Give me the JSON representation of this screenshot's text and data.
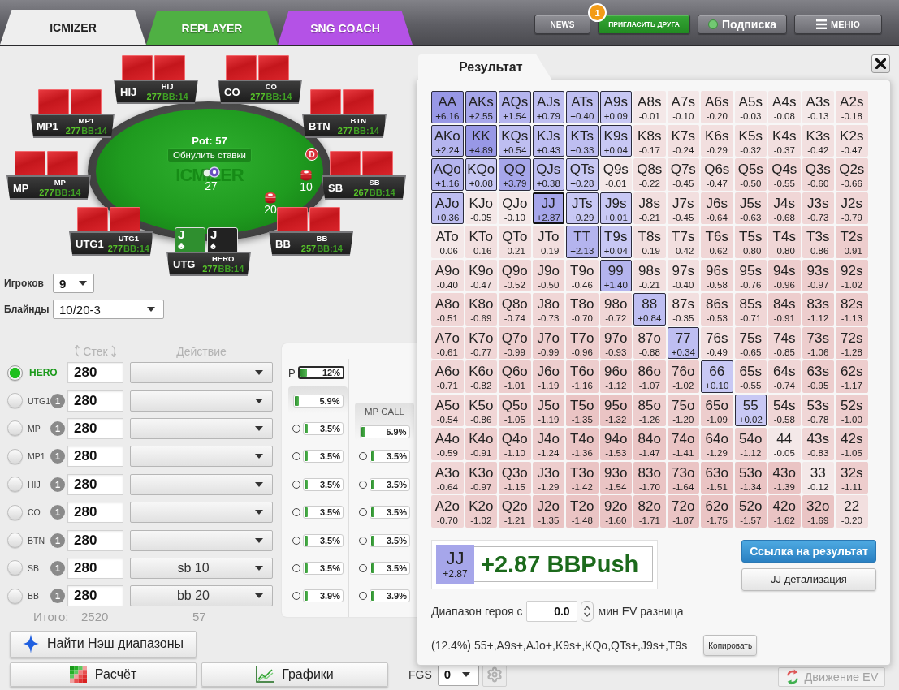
{
  "tabs": [
    {
      "label": "ICMIZER",
      "selected": true,
      "color": "#eeeeee"
    },
    {
      "label": "REPLAYER",
      "selected": false,
      "color": "#4fb043"
    },
    {
      "label": "SNG COACH",
      "selected": false,
      "color": "#b452e6"
    }
  ],
  "header_buttons": [
    {
      "kind": "plain",
      "label": "NEWS"
    },
    {
      "kind": "invite",
      "label": "ПРИГЛАСИТЬ ДРУГА",
      "badge": "1"
    },
    {
      "kind": "status",
      "label": "Подписка",
      "active": true
    },
    {
      "kind": "menu",
      "label": "МЕНЮ"
    }
  ],
  "table": {
    "pot": "Pot: 57",
    "reset_button": "Обнулить ставки",
    "felt_logo": "ICMIZER",
    "antes": "27",
    "dealer_button": "D",
    "seats": [
      {
        "position": "HIJ",
        "name": "HIJ",
        "stack": "277",
        "big_blinds": "BB:14",
        "cards": [
          {
            "face_up": false
          },
          {
            "face_up": false
          }
        ]
      },
      {
        "position": "CO",
        "name": "CO",
        "stack": "277",
        "big_blinds": "BB:14",
        "cards": [
          {
            "face_up": false
          },
          {
            "face_up": false
          }
        ]
      },
      {
        "position": "MP1",
        "name": "MP1",
        "stack": "277",
        "big_blinds": "BB:14",
        "cards": [
          {
            "face_up": false
          },
          {
            "face_up": false
          }
        ]
      },
      {
        "position": "BTN",
        "name": "BTN",
        "stack": "277",
        "big_blinds": "BB:14",
        "cards": [
          {
            "face_up": false
          },
          {
            "face_up": false
          }
        ]
      },
      {
        "position": "MP",
        "name": "MP",
        "stack": "277",
        "big_blinds": "BB:14",
        "cards": [
          {
            "face_up": false
          },
          {
            "face_up": false
          }
        ]
      },
      {
        "position": "SB",
        "name": "SB",
        "stack": "267",
        "big_blinds": "BB:14",
        "bet": "10",
        "cards": [
          {
            "face_up": false
          },
          {
            "face_up": false
          }
        ]
      },
      {
        "position": "UTG1",
        "name": "UTG1",
        "stack": "277",
        "big_blinds": "BB:14",
        "cards": [
          {
            "face_up": false
          },
          {
            "face_up": false
          }
        ]
      },
      {
        "position": "BB",
        "name": "BB",
        "stack": "257",
        "big_blinds": "BB:14",
        "bet": "20",
        "cards": [
          {
            "face_up": false
          },
          {
            "face_up": false
          }
        ]
      },
      {
        "position": "UTG",
        "name": "HERO",
        "stack": "277",
        "big_blinds": "BB:14",
        "cards": [
          {
            "face_up": true,
            "rank": "J",
            "suit": "♣",
            "color": "#2f8f2f"
          },
          {
            "face_up": true,
            "rank": "J",
            "suit": "♠",
            "color": "#222222"
          }
        ]
      }
    ]
  },
  "settings": [
    {
      "label": "Игроков",
      "value": "9"
    },
    {
      "label": "Блайнды",
      "value": "10/20-3"
    }
  ],
  "players_header": {
    "stack": "Стек",
    "action": "Действие"
  },
  "players": [
    {
      "name": "HERO",
      "selected": true,
      "stack": "280"
    },
    {
      "name": "UTG1",
      "selected": false,
      "badge": "1",
      "stack": "280"
    },
    {
      "name": "MP",
      "selected": false,
      "badge": "1",
      "stack": "280"
    },
    {
      "name": "MP1",
      "selected": false,
      "badge": "1",
      "stack": "280"
    },
    {
      "name": "HIJ",
      "selected": false,
      "badge": "1",
      "stack": "280"
    },
    {
      "name": "CO",
      "selected": false,
      "badge": "1",
      "stack": "280"
    },
    {
      "name": "BTN",
      "selected": false,
      "badge": "1",
      "stack": "280"
    },
    {
      "name": "SB",
      "selected": false,
      "badge": "1",
      "stack": "280",
      "action": "sb 10"
    },
    {
      "name": "BB",
      "selected": false,
      "badge": "1",
      "stack": "280",
      "action": "bb 20"
    }
  ],
  "totals": {
    "label": "Итого:",
    "stack": "2520",
    "bets": "57"
  },
  "range_columns": [
    {
      "lead": {
        "letter": "P",
        "reading": "12%",
        "level": 0.12
      },
      "head": {
        "reading": "5.9%",
        "level": 0.059
      },
      "rows": [
        {
          "reading": "3.5%",
          "level": 0.035
        },
        {
          "reading": "3.5%",
          "level": 0.035
        },
        {
          "reading": "3.5%",
          "level": 0.035
        },
        {
          "reading": "3.5%",
          "level": 0.035
        },
        {
          "reading": "3.5%",
          "level": 0.035
        },
        {
          "reading": "3.5%",
          "level": 0.035
        },
        {
          "reading": "3.9%",
          "level": 0.039
        }
      ]
    },
    {
      "title": "MP CALL",
      "head": {
        "reading": "5.9%",
        "level": 0.059
      },
      "rows": [
        {
          "reading": "3.5%",
          "level": 0.035
        },
        {
          "reading": "3.5%",
          "level": 0.035
        },
        {
          "reading": "3.5%",
          "level": 0.035
        },
        {
          "reading": "3.5%",
          "level": 0.035
        },
        {
          "reading": "3.5%",
          "level": 0.035
        },
        {
          "reading": "3.9%",
          "level": 0.039
        }
      ]
    }
  ],
  "nash_button": "Найти Нэш диапазоны",
  "bottom_bar": {
    "calc_button": "Расчёт",
    "charts_button": "Графики",
    "fgs_label": "FGS",
    "fgs_value": "0",
    "ev_button": {
      "label": "Движение EV",
      "disabled": true
    }
  },
  "result": {
    "tab": "Результат",
    "grid": [
      [
        {
          "hand": "AA",
          "ev": "+6.16",
          "color": "#9898e6",
          "push": true,
          "selected": false
        },
        {
          "hand": "AKs",
          "ev": "+2.55",
          "color": "#a6a6ea",
          "push": true,
          "selected": false
        },
        {
          "hand": "AQs",
          "ev": "+1.54",
          "color": "#b4b4ee",
          "push": true,
          "selected": false
        },
        {
          "hand": "AJs",
          "ev": "+0.79",
          "color": "#bebef1",
          "push": true,
          "selected": false
        },
        {
          "hand": "ATs",
          "ev": "+0.40",
          "color": "#bebef1",
          "push": true,
          "selected": false
        },
        {
          "hand": "A9s",
          "ev": "+0.09",
          "color": "#c8c8f4",
          "push": true,
          "selected": false
        },
        {
          "hand": "A8s",
          "ev": "-0.01",
          "color": "#f4e8e8",
          "push": false,
          "selected": false
        },
        {
          "hand": "A7s",
          "ev": "-0.10",
          "color": "#f4e8e8",
          "push": false,
          "selected": false
        },
        {
          "hand": "A6s",
          "ev": "-0.20",
          "color": "#f2dfdf",
          "push": false,
          "selected": false
        },
        {
          "hand": "A5s",
          "ev": "-0.03",
          "color": "#f4e8e8",
          "push": false,
          "selected": false
        },
        {
          "hand": "A4s",
          "ev": "-0.08",
          "color": "#f4e8e8",
          "push": false,
          "selected": false
        },
        {
          "hand": "A3s",
          "ev": "-0.13",
          "color": "#f4e8e8",
          "push": false,
          "selected": false
        },
        {
          "hand": "A2s",
          "ev": "-0.18",
          "color": "#f2dfdf",
          "push": false,
          "selected": false
        }
      ],
      [
        {
          "hand": "AKo",
          "ev": "+2.24",
          "color": "#b4b4ee",
          "push": true,
          "selected": false
        },
        {
          "hand": "KK",
          "ev": "+4.89",
          "color": "#9898e6",
          "push": true,
          "selected": false
        },
        {
          "hand": "KQs",
          "ev": "+0.54",
          "color": "#bebef1",
          "push": true,
          "selected": false
        },
        {
          "hand": "KJs",
          "ev": "+0.43",
          "color": "#bebef1",
          "push": true,
          "selected": false
        },
        {
          "hand": "KTs",
          "ev": "+0.33",
          "color": "#bebef1",
          "push": true,
          "selected": false
        },
        {
          "hand": "K9s",
          "ev": "+0.04",
          "color": "#c8c8f4",
          "push": true,
          "selected": false
        },
        {
          "hand": "K8s",
          "ev": "-0.17",
          "color": "#f2dfdf",
          "push": false,
          "selected": false
        },
        {
          "hand": "K7s",
          "ev": "-0.24",
          "color": "#f2dfdf",
          "push": false,
          "selected": false
        },
        {
          "hand": "K6s",
          "ev": "-0.29",
          "color": "#f2dfdf",
          "push": false,
          "selected": false
        },
        {
          "hand": "K5s",
          "ev": "-0.32",
          "color": "#f2dfdf",
          "push": false,
          "selected": false
        },
        {
          "hand": "K4s",
          "ev": "-0.37",
          "color": "#f2dfdf",
          "push": false,
          "selected": false
        },
        {
          "hand": "K3s",
          "ev": "-0.42",
          "color": "#f2dfdf",
          "push": false,
          "selected": false
        },
        {
          "hand": "K2s",
          "ev": "-0.47",
          "color": "#f2dfdf",
          "push": false,
          "selected": false
        }
      ],
      [
        {
          "hand": "AQo",
          "ev": "+1.16",
          "color": "#b4b4ee",
          "push": true,
          "selected": false
        },
        {
          "hand": "KQo",
          "ev": "+0.08",
          "color": "#c8c8f4",
          "push": true,
          "selected": false
        },
        {
          "hand": "QQ",
          "ev": "+3.79",
          "color": "#a6a6ea",
          "push": true,
          "selected": false
        },
        {
          "hand": "QJs",
          "ev": "+0.38",
          "color": "#bebef1",
          "push": true,
          "selected": false
        },
        {
          "hand": "QTs",
          "ev": "+0.28",
          "color": "#c8c8f4",
          "push": true,
          "selected": false
        },
        {
          "hand": "Q9s",
          "ev": "-0.01",
          "color": "#f4e8e8",
          "push": false,
          "selected": false
        },
        {
          "hand": "Q8s",
          "ev": "-0.22",
          "color": "#f2dfdf",
          "push": false,
          "selected": false
        },
        {
          "hand": "Q7s",
          "ev": "-0.45",
          "color": "#f2dfdf",
          "push": false,
          "selected": false
        },
        {
          "hand": "Q6s",
          "ev": "-0.47",
          "color": "#f2dfdf",
          "push": false,
          "selected": false
        },
        {
          "hand": "Q5s",
          "ev": "-0.50",
          "color": "#f0d6d6",
          "push": false,
          "selected": false
        },
        {
          "hand": "Q4s",
          "ev": "-0.55",
          "color": "#f0d6d6",
          "push": false,
          "selected": false
        },
        {
          "hand": "Q3s",
          "ev": "-0.60",
          "color": "#f0d6d6",
          "push": false,
          "selected": false
        },
        {
          "hand": "Q2s",
          "ev": "-0.66",
          "color": "#f0d6d6",
          "push": false,
          "selected": false
        }
      ],
      [
        {
          "hand": "AJo",
          "ev": "+0.36",
          "color": "#bebef1",
          "push": true,
          "selected": false
        },
        {
          "hand": "KJo",
          "ev": "-0.05",
          "color": "#f4e8e8",
          "push": false,
          "selected": false
        },
        {
          "hand": "QJo",
          "ev": "-0.10",
          "color": "#f4e8e8",
          "push": false,
          "selected": false
        },
        {
          "hand": "JJ",
          "ev": "+2.87",
          "color": "#a6a6ea",
          "push": true,
          "selected": true
        },
        {
          "hand": "JTs",
          "ev": "+0.29",
          "color": "#c8c8f4",
          "push": true,
          "selected": false
        },
        {
          "hand": "J9s",
          "ev": "+0.01",
          "color": "#c8c8f4",
          "push": true,
          "selected": false
        },
        {
          "hand": "J8s",
          "ev": "-0.21",
          "color": "#f2dfdf",
          "push": false,
          "selected": false
        },
        {
          "hand": "J7s",
          "ev": "-0.45",
          "color": "#f2dfdf",
          "push": false,
          "selected": false
        },
        {
          "hand": "J6s",
          "ev": "-0.64",
          "color": "#f0d6d6",
          "push": false,
          "selected": false
        },
        {
          "hand": "J5s",
          "ev": "-0.63",
          "color": "#f0d6d6",
          "push": false,
          "selected": false
        },
        {
          "hand": "J4s",
          "ev": "-0.68",
          "color": "#f0d6d6",
          "push": false,
          "selected": false
        },
        {
          "hand": "J3s",
          "ev": "-0.73",
          "color": "#f0d6d6",
          "push": false,
          "selected": false
        },
        {
          "hand": "J2s",
          "ev": "-0.79",
          "color": "#f0d6d6",
          "push": false,
          "selected": false
        }
      ],
      [
        {
          "hand": "ATo",
          "ev": "-0.06",
          "color": "#f4e8e8",
          "push": false,
          "selected": false
        },
        {
          "hand": "KTo",
          "ev": "-0.16",
          "color": "#f2dfdf",
          "push": false,
          "selected": false
        },
        {
          "hand": "QTo",
          "ev": "-0.21",
          "color": "#f2dfdf",
          "push": false,
          "selected": false
        },
        {
          "hand": "JTo",
          "ev": "-0.19",
          "color": "#f2dfdf",
          "push": false,
          "selected": false
        },
        {
          "hand": "TT",
          "ev": "+2.13",
          "color": "#b4b4ee",
          "push": true,
          "selected": false
        },
        {
          "hand": "T9s",
          "ev": "+0.04",
          "color": "#c8c8f4",
          "push": true,
          "selected": false
        },
        {
          "hand": "T8s",
          "ev": "-0.19",
          "color": "#f2dfdf",
          "push": false,
          "selected": false
        },
        {
          "hand": "T7s",
          "ev": "-0.42",
          "color": "#f2dfdf",
          "push": false,
          "selected": false
        },
        {
          "hand": "T6s",
          "ev": "-0.62",
          "color": "#f0d6d6",
          "push": false,
          "selected": false
        },
        {
          "hand": "T5s",
          "ev": "-0.80",
          "color": "#f0d6d6",
          "push": false,
          "selected": false
        },
        {
          "hand": "T4s",
          "ev": "-0.80",
          "color": "#f0d6d6",
          "push": false,
          "selected": false
        },
        {
          "hand": "T3s",
          "ev": "-0.86",
          "color": "#f0d6d6",
          "push": false,
          "selected": false
        },
        {
          "hand": "T2s",
          "ev": "-0.91",
          "color": "#edcdcd",
          "push": false,
          "selected": false
        }
      ],
      [
        {
          "hand": "A9o",
          "ev": "-0.40",
          "color": "#f2dfdf",
          "push": false,
          "selected": false
        },
        {
          "hand": "K9o",
          "ev": "-0.47",
          "color": "#f2dfdf",
          "push": false,
          "selected": false
        },
        {
          "hand": "Q9o",
          "ev": "-0.52",
          "color": "#f0d6d6",
          "push": false,
          "selected": false
        },
        {
          "hand": "J9o",
          "ev": "-0.50",
          "color": "#f0d6d6",
          "push": false,
          "selected": false
        },
        {
          "hand": "T9o",
          "ev": "-0.46",
          "color": "#f2dfdf",
          "push": false,
          "selected": false
        },
        {
          "hand": "99",
          "ev": "+1.40",
          "color": "#b4b4ee",
          "push": true,
          "selected": false
        },
        {
          "hand": "98s",
          "ev": "-0.21",
          "color": "#f2dfdf",
          "push": false,
          "selected": false
        },
        {
          "hand": "97s",
          "ev": "-0.40",
          "color": "#f2dfdf",
          "push": false,
          "selected": false
        },
        {
          "hand": "96s",
          "ev": "-0.58",
          "color": "#f0d6d6",
          "push": false,
          "selected": false
        },
        {
          "hand": "95s",
          "ev": "-0.76",
          "color": "#f0d6d6",
          "push": false,
          "selected": false
        },
        {
          "hand": "94s",
          "ev": "-0.96",
          "color": "#edcdcd",
          "push": false,
          "selected": false
        },
        {
          "hand": "93s",
          "ev": "-0.97",
          "color": "#edcdcd",
          "push": false,
          "selected": false
        },
        {
          "hand": "92s",
          "ev": "-1.02",
          "color": "#edcdcd",
          "push": false,
          "selected": false
        }
      ],
      [
        {
          "hand": "A8o",
          "ev": "-0.51",
          "color": "#f0d6d6",
          "push": false,
          "selected": false
        },
        {
          "hand": "K8o",
          "ev": "-0.69",
          "color": "#f0d6d6",
          "push": false,
          "selected": false
        },
        {
          "hand": "Q8o",
          "ev": "-0.74",
          "color": "#f0d6d6",
          "push": false,
          "selected": false
        },
        {
          "hand": "J8o",
          "ev": "-0.73",
          "color": "#f0d6d6",
          "push": false,
          "selected": false
        },
        {
          "hand": "T8o",
          "ev": "-0.70",
          "color": "#f0d6d6",
          "push": false,
          "selected": false
        },
        {
          "hand": "98o",
          "ev": "-0.72",
          "color": "#f0d6d6",
          "push": false,
          "selected": false
        },
        {
          "hand": "88",
          "ev": "+0.84",
          "color": "#bebef1",
          "push": true,
          "selected": false
        },
        {
          "hand": "87s",
          "ev": "-0.35",
          "color": "#f2dfdf",
          "push": false,
          "selected": false
        },
        {
          "hand": "86s",
          "ev": "-0.53",
          "color": "#f0d6d6",
          "push": false,
          "selected": false
        },
        {
          "hand": "85s",
          "ev": "-0.71",
          "color": "#f0d6d6",
          "push": false,
          "selected": false
        },
        {
          "hand": "84s",
          "ev": "-0.91",
          "color": "#edcdcd",
          "push": false,
          "selected": false
        },
        {
          "hand": "83s",
          "ev": "-1.12",
          "color": "#edcdcd",
          "push": false,
          "selected": false
        },
        {
          "hand": "82s",
          "ev": "-1.13",
          "color": "#edcdcd",
          "push": false,
          "selected": false
        }
      ],
      [
        {
          "hand": "A7o",
          "ev": "-0.61",
          "color": "#f0d6d6",
          "push": false,
          "selected": false
        },
        {
          "hand": "K7o",
          "ev": "-0.77",
          "color": "#f0d6d6",
          "push": false,
          "selected": false
        },
        {
          "hand": "Q7o",
          "ev": "-0.99",
          "color": "#edcdcd",
          "push": false,
          "selected": false
        },
        {
          "hand": "J7o",
          "ev": "-0.99",
          "color": "#edcdcd",
          "push": false,
          "selected": false
        },
        {
          "hand": "T7o",
          "ev": "-0.96",
          "color": "#edcdcd",
          "push": false,
          "selected": false
        },
        {
          "hand": "97o",
          "ev": "-0.93",
          "color": "#edcdcd",
          "push": false,
          "selected": false
        },
        {
          "hand": "87o",
          "ev": "-0.88",
          "color": "#f0d6d6",
          "push": false,
          "selected": false
        },
        {
          "hand": "77",
          "ev": "+0.34",
          "color": "#bebef1",
          "push": true,
          "selected": false
        },
        {
          "hand": "76s",
          "ev": "-0.49",
          "color": "#f2dfdf",
          "push": false,
          "selected": false
        },
        {
          "hand": "75s",
          "ev": "-0.65",
          "color": "#f0d6d6",
          "push": false,
          "selected": false
        },
        {
          "hand": "74s",
          "ev": "-0.85",
          "color": "#f0d6d6",
          "push": false,
          "selected": false
        },
        {
          "hand": "73s",
          "ev": "-1.06",
          "color": "#edcdcd",
          "push": false,
          "selected": false
        },
        {
          "hand": "72s",
          "ev": "-1.28",
          "color": "#edcdcd",
          "push": false,
          "selected": false
        }
      ],
      [
        {
          "hand": "A6o",
          "ev": "-0.71",
          "color": "#f0d6d6",
          "push": false,
          "selected": false
        },
        {
          "hand": "K6o",
          "ev": "-0.82",
          "color": "#f0d6d6",
          "push": false,
          "selected": false
        },
        {
          "hand": "Q6o",
          "ev": "-1.01",
          "color": "#edcdcd",
          "push": false,
          "selected": false
        },
        {
          "hand": "J6o",
          "ev": "-1.19",
          "color": "#edcdcd",
          "push": false,
          "selected": false
        },
        {
          "hand": "T6o",
          "ev": "-1.16",
          "color": "#edcdcd",
          "push": false,
          "selected": false
        },
        {
          "hand": "96o",
          "ev": "-1.12",
          "color": "#edcdcd",
          "push": false,
          "selected": false
        },
        {
          "hand": "86o",
          "ev": "-1.07",
          "color": "#edcdcd",
          "push": false,
          "selected": false
        },
        {
          "hand": "76o",
          "ev": "-1.02",
          "color": "#edcdcd",
          "push": false,
          "selected": false
        },
        {
          "hand": "66",
          "ev": "+0.10",
          "color": "#c8c8f4",
          "push": true,
          "selected": false
        },
        {
          "hand": "65s",
          "ev": "-0.55",
          "color": "#f0d6d6",
          "push": false,
          "selected": false
        },
        {
          "hand": "64s",
          "ev": "-0.74",
          "color": "#f0d6d6",
          "push": false,
          "selected": false
        },
        {
          "hand": "63s",
          "ev": "-0.95",
          "color": "#edcdcd",
          "push": false,
          "selected": false
        },
        {
          "hand": "62s",
          "ev": "-1.17",
          "color": "#edcdcd",
          "push": false,
          "selected": false
        }
      ],
      [
        {
          "hand": "A5o",
          "ev": "-0.54",
          "color": "#f0d6d6",
          "push": false,
          "selected": false
        },
        {
          "hand": "K5o",
          "ev": "-0.86",
          "color": "#f0d6d6",
          "push": false,
          "selected": false
        },
        {
          "hand": "Q5o",
          "ev": "-1.05",
          "color": "#edcdcd",
          "push": false,
          "selected": false
        },
        {
          "hand": "J5o",
          "ev": "-1.19",
          "color": "#edcdcd",
          "push": false,
          "selected": false
        },
        {
          "hand": "T5o",
          "ev": "-1.35",
          "color": "#eac4c4",
          "push": false,
          "selected": false
        },
        {
          "hand": "95o",
          "ev": "-1.32",
          "color": "#eac4c4",
          "push": false,
          "selected": false
        },
        {
          "hand": "85o",
          "ev": "-1.26",
          "color": "#edcdcd",
          "push": false,
          "selected": false
        },
        {
          "hand": "75o",
          "ev": "-1.20",
          "color": "#edcdcd",
          "push": false,
          "selected": false
        },
        {
          "hand": "65o",
          "ev": "-1.09",
          "color": "#edcdcd",
          "push": false,
          "selected": false
        },
        {
          "hand": "55",
          "ev": "+0.02",
          "color": "#c8c8f4",
          "push": true,
          "selected": false
        },
        {
          "hand": "54s",
          "ev": "-0.58",
          "color": "#f0d6d6",
          "push": false,
          "selected": false
        },
        {
          "hand": "53s",
          "ev": "-0.78",
          "color": "#f0d6d6",
          "push": false,
          "selected": false
        },
        {
          "hand": "52s",
          "ev": "-1.00",
          "color": "#edcdcd",
          "push": false,
          "selected": false
        }
      ],
      [
        {
          "hand": "A4o",
          "ev": "-0.59",
          "color": "#f0d6d6",
          "push": false,
          "selected": false
        },
        {
          "hand": "K4o",
          "ev": "-0.91",
          "color": "#edcdcd",
          "push": false,
          "selected": false
        },
        {
          "hand": "Q4o",
          "ev": "-1.10",
          "color": "#edcdcd",
          "push": false,
          "selected": false
        },
        {
          "hand": "J4o",
          "ev": "-1.24",
          "color": "#edcdcd",
          "push": false,
          "selected": false
        },
        {
          "hand": "T4o",
          "ev": "-1.36",
          "color": "#eac4c4",
          "push": false,
          "selected": false
        },
        {
          "hand": "94o",
          "ev": "-1.53",
          "color": "#eac4c4",
          "push": false,
          "selected": false
        },
        {
          "hand": "84o",
          "ev": "-1.47",
          "color": "#eac4c4",
          "push": false,
          "selected": false
        },
        {
          "hand": "74o",
          "ev": "-1.41",
          "color": "#eac4c4",
          "push": false,
          "selected": false
        },
        {
          "hand": "64o",
          "ev": "-1.29",
          "color": "#edcdcd",
          "push": false,
          "selected": false
        },
        {
          "hand": "54o",
          "ev": "-1.12",
          "color": "#edcdcd",
          "push": false,
          "selected": false
        },
        {
          "hand": "44",
          "ev": "-0.05",
          "color": "#f4e8e8",
          "push": false,
          "selected": false
        },
        {
          "hand": "43s",
          "ev": "-0.83",
          "color": "#f0d6d6",
          "push": false,
          "selected": false
        },
        {
          "hand": "42s",
          "ev": "-1.05",
          "color": "#edcdcd",
          "push": false,
          "selected": false
        }
      ],
      [
        {
          "hand": "A3o",
          "ev": "-0.64",
          "color": "#f0d6d6",
          "push": false,
          "selected": false
        },
        {
          "hand": "K3o",
          "ev": "-0.97",
          "color": "#edcdcd",
          "push": false,
          "selected": false
        },
        {
          "hand": "Q3o",
          "ev": "-1.15",
          "color": "#edcdcd",
          "push": false,
          "selected": false
        },
        {
          "hand": "J3o",
          "ev": "-1.29",
          "color": "#edcdcd",
          "push": false,
          "selected": false
        },
        {
          "hand": "T3o",
          "ev": "-1.42",
          "color": "#eac4c4",
          "push": false,
          "selected": false
        },
        {
          "hand": "93o",
          "ev": "-1.54",
          "color": "#eac4c4",
          "push": false,
          "selected": false
        },
        {
          "hand": "83o",
          "ev": "-1.70",
          "color": "#eac4c4",
          "push": false,
          "selected": false
        },
        {
          "hand": "73o",
          "ev": "-1.64",
          "color": "#eac4c4",
          "push": false,
          "selected": false
        },
        {
          "hand": "63o",
          "ev": "-1.51",
          "color": "#eac4c4",
          "push": false,
          "selected": false
        },
        {
          "hand": "53o",
          "ev": "-1.34",
          "color": "#eac4c4",
          "push": false,
          "selected": false
        },
        {
          "hand": "43o",
          "ev": "-1.39",
          "color": "#eac4c4",
          "push": false,
          "selected": false
        },
        {
          "hand": "33",
          "ev": "-0.12",
          "color": "#f4e8e8",
          "push": false,
          "selected": false
        },
        {
          "hand": "32s",
          "ev": "-1.11",
          "color": "#edcdcd",
          "push": false,
          "selected": false
        }
      ],
      [
        {
          "hand": "A2o",
          "ev": "-0.70",
          "color": "#f0d6d6",
          "push": false,
          "selected": false
        },
        {
          "hand": "K2o",
          "ev": "-1.02",
          "color": "#edcdcd",
          "push": false,
          "selected": false
        },
        {
          "hand": "Q2o",
          "ev": "-1.21",
          "color": "#edcdcd",
          "push": false,
          "selected": false
        },
        {
          "hand": "J2o",
          "ev": "-1.35",
          "color": "#eac4c4",
          "push": false,
          "selected": false
        },
        {
          "hand": "T2o",
          "ev": "-1.48",
          "color": "#eac4c4",
          "push": false,
          "selected": false
        },
        {
          "hand": "92o",
          "ev": "-1.60",
          "color": "#eac4c4",
          "push": false,
          "selected": false
        },
        {
          "hand": "82o",
          "ev": "-1.71",
          "color": "#eac4c4",
          "push": false,
          "selected": false
        },
        {
          "hand": "72o",
          "ev": "-1.87",
          "color": "#eac4c4",
          "push": false,
          "selected": false
        },
        {
          "hand": "62o",
          "ev": "-1.75",
          "color": "#eac4c4",
          "push": false,
          "selected": false
        },
        {
          "hand": "52o",
          "ev": "-1.57",
          "color": "#eac4c4",
          "push": false,
          "selected": false
        },
        {
          "hand": "42o",
          "ev": "-1.62",
          "color": "#eac4c4",
          "push": false,
          "selected": false
        },
        {
          "hand": "32o",
          "ev": "-1.69",
          "color": "#eac4c4",
          "push": false,
          "selected": false
        },
        {
          "hand": "22",
          "ev": "-0.20",
          "color": "#f2dfdf",
          "push": false,
          "selected": false
        }
      ]
    ],
    "summary": {
      "hand": "JJ",
      "ev": "+2.87",
      "verdict": "+2.87 BBPush",
      "color": "#a6a6ea"
    },
    "link_button": "Ссылка на результат",
    "detail_button": "JJ детализация",
    "filter": {
      "label": "Диапазон героя с",
      "value": "0.0",
      "suffix": "мин EV разница"
    },
    "range_text": "(12.4%) 55+,A9s+,AJo+,K9s+,KQo,QTs+,J9s+,T9s",
    "copy_button": "Копировать"
  }
}
